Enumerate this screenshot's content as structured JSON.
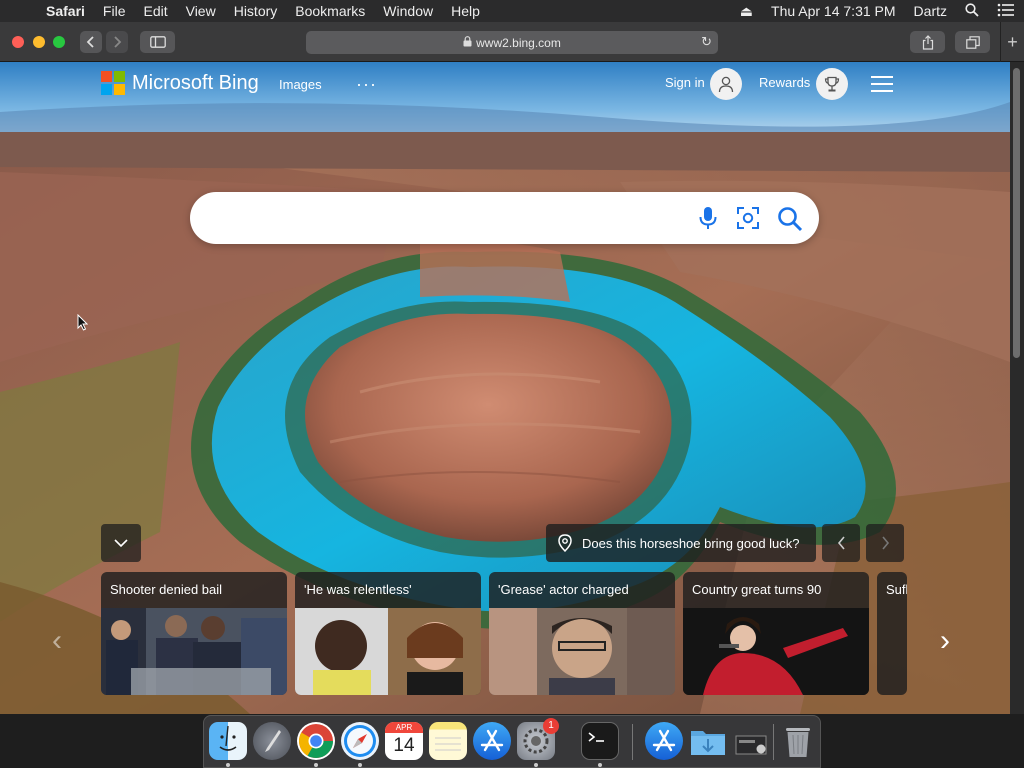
{
  "menubar": {
    "app": "Safari",
    "items": [
      "File",
      "Edit",
      "View",
      "History",
      "Bookmarks",
      "Window",
      "Help"
    ],
    "datetime": "Thu Apr 14  7:31 PM",
    "user": "Dartz"
  },
  "browser": {
    "url": "www2.bing.com"
  },
  "bing": {
    "logo_text": "Microsoft Bing",
    "nav_images": "Images",
    "more": "···",
    "sign_in": "Sign in",
    "rewards": "Rewards",
    "search_placeholder": ""
  },
  "image_fact": "Does this horseshoe bring good luck?",
  "news": [
    {
      "title": "Shooter denied bail"
    },
    {
      "title": "'He was relentless'"
    },
    {
      "title": "'Grease' actor charged"
    },
    {
      "title": "Country great turns 90"
    },
    {
      "title": "Sufl"
    }
  ],
  "dock": {
    "calendar_month": "APR",
    "calendar_day": "14",
    "settings_badge": "1"
  },
  "colors": {
    "ms_red": "#f25022",
    "ms_green": "#7fba00",
    "ms_blue": "#00a4ef",
    "ms_yellow": "#ffb900",
    "bing_blue": "#1a73e8"
  }
}
